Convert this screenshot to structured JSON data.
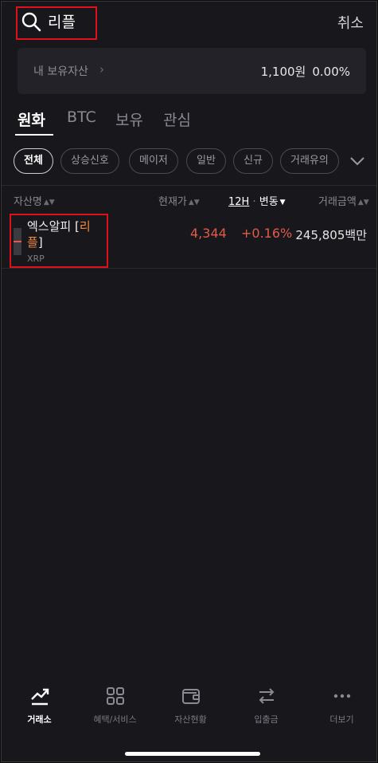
{
  "search": {
    "value": "리플",
    "cancel_label": "취소"
  },
  "holdings": {
    "label": "내 보유자산",
    "chevron": "›",
    "amount": "1,100원",
    "rate": "0.00%"
  },
  "tabs": [
    {
      "label": "원화",
      "active": true
    },
    {
      "label": "BTC",
      "active": false
    },
    {
      "label": "보유",
      "active": false
    },
    {
      "label": "관심",
      "active": false
    }
  ],
  "chips": [
    {
      "label": "전체",
      "active": true
    },
    {
      "label": "상승신호"
    },
    {
      "label": "메이저"
    },
    {
      "label": "일반"
    },
    {
      "label": "신규"
    },
    {
      "label": "거래유의"
    }
  ],
  "columns": {
    "asset": "자산명",
    "price": "현재가",
    "period": "12H",
    "dot": "·",
    "change": "변동",
    "volume": "거래금액"
  },
  "asset": {
    "name_prefix": "엑스알피 [",
    "name_highlight_1": "리",
    "name_highlight_2": "플",
    "name_suffix": "]",
    "symbol": "XRP",
    "price": "4,344",
    "change": "+0.16%",
    "volume": "245,805백만"
  },
  "nav": [
    {
      "label": "거래소",
      "icon": "trend-chart-icon",
      "active": true
    },
    {
      "label": "혜택/서비스",
      "icon": "grid-icon"
    },
    {
      "label": "자산현황",
      "icon": "wallet-icon"
    },
    {
      "label": "입출금",
      "icon": "transfer-arrows-icon"
    },
    {
      "label": "더보기",
      "icon": "more-dots-icon"
    }
  ],
  "colors": {
    "rise": "#e25b48",
    "highlight": "#f08a3c",
    "annotation": "#e0101a"
  }
}
